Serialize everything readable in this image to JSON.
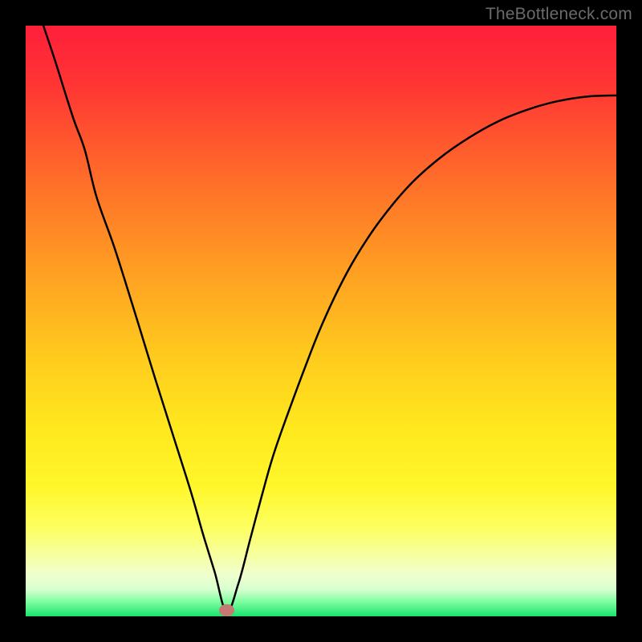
{
  "watermark": "TheBottleneck.com",
  "marker": {
    "cx": 0.34,
    "cy": 0.99,
    "rx": 0.013,
    "ry": 0.01,
    "color": "#c77a72"
  },
  "gradient_stops": [
    {
      "offset": 0.0,
      "color": "#ff1f3a"
    },
    {
      "offset": 0.1,
      "color": "#ff3534"
    },
    {
      "offset": 0.25,
      "color": "#ff6a2a"
    },
    {
      "offset": 0.4,
      "color": "#ff9a23"
    },
    {
      "offset": 0.55,
      "color": "#ffc81e"
    },
    {
      "offset": 0.68,
      "color": "#ffe81e"
    },
    {
      "offset": 0.78,
      "color": "#fff72a"
    },
    {
      "offset": 0.85,
      "color": "#fdff60"
    },
    {
      "offset": 0.9,
      "color": "#f6ffa6"
    },
    {
      "offset": 0.93,
      "color": "#efffce"
    },
    {
      "offset": 0.955,
      "color": "#d7ffcf"
    },
    {
      "offset": 0.975,
      "color": "#7effa0"
    },
    {
      "offset": 1.0,
      "color": "#19e36e"
    }
  ],
  "chart_data": {
    "type": "line",
    "title": "",
    "xlabel": "",
    "ylabel": "",
    "xlim": [
      0,
      1
    ],
    "ylim": [
      0,
      1
    ],
    "grid": false,
    "legend": false,
    "series": [
      {
        "name": "curve",
        "color": "#000000",
        "x": [
          0.03,
          0.05,
          0.08,
          0.1,
          0.12,
          0.15,
          0.18,
          0.2,
          0.22,
          0.25,
          0.28,
          0.3,
          0.32,
          0.34,
          0.36,
          0.38,
          0.4,
          0.42,
          0.45,
          0.48,
          0.5,
          0.53,
          0.56,
          0.6,
          0.65,
          0.7,
          0.75,
          0.8,
          0.85,
          0.9,
          0.95,
          1.0
        ],
        "y": [
          1.0,
          0.94,
          0.845,
          0.79,
          0.71,
          0.625,
          0.53,
          0.465,
          0.4,
          0.305,
          0.21,
          0.14,
          0.075,
          0.008,
          0.055,
          0.13,
          0.205,
          0.275,
          0.36,
          0.44,
          0.49,
          0.555,
          0.61,
          0.67,
          0.73,
          0.775,
          0.81,
          0.838,
          0.858,
          0.872,
          0.88,
          0.882
        ]
      }
    ]
  }
}
